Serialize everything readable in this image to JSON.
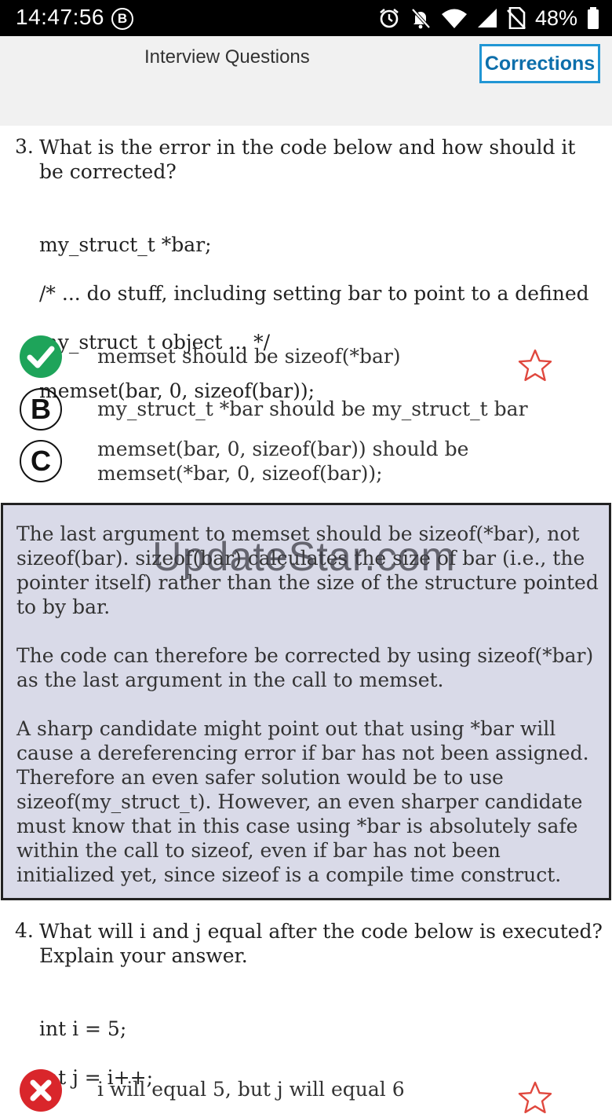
{
  "status_bar": {
    "time": "14:47:56",
    "b_icon": "B",
    "battery": "48%"
  },
  "header": {
    "title": "Interview Questions",
    "corrections_label": "Corrections"
  },
  "question3": {
    "number": "3.",
    "text": "What is the error in the code below and how should it be corrected?",
    "code": [
      "my_struct_t *bar;",
      "/* ... do stuff, including setting bar to point to a defined",
      "my_struct_t object ... */",
      "memset(bar, 0, sizeof(bar));"
    ],
    "answers": [
      {
        "label": "",
        "text": "memset should be sizeof(*bar)",
        "state": "correct"
      },
      {
        "label": "B",
        "text": "my_struct_t *bar should be my_struct_t bar",
        "state": "option"
      },
      {
        "label": "C",
        "text": "memset(bar, 0, sizeof(bar)) should be memset(*bar, 0, sizeof(bar));",
        "state": "option"
      }
    ],
    "explanation": [
      "The last argument to memset should be sizeof(*bar), not sizeof(bar). sizeof(bar) calculates the size of bar (i.e., the pointer itself) rather than the size of the structure pointed to by bar.",
      "The code can therefore be corrected by using sizeof(*bar) as the last argument in the call to memset.",
      "A sharp candidate might point out that using *bar will cause a dereferencing error if bar has not been assigned. Therefore an even safer solution would be to use sizeof(my_struct_t). However, an even sharper candidate must know that in this case using *bar is absolutely safe within the call to sizeof, even if bar has not been initialized yet, since sizeof is a compile time construct."
    ],
    "watermark": "UpdateStar.com"
  },
  "question4": {
    "number": "4.",
    "text": "What will i and j equal after the code below is executed? Explain your answer.",
    "code": [
      "int i = 5;",
      "int j = i++;"
    ],
    "answer_partial": "i will equal 5, but j will equal 6"
  },
  "colors": {
    "accent": "#2196d4",
    "correct": "#1ea45a",
    "wrong": "#d9262b",
    "star": "#e0483e",
    "explanation_bg": "#d9dae8"
  }
}
